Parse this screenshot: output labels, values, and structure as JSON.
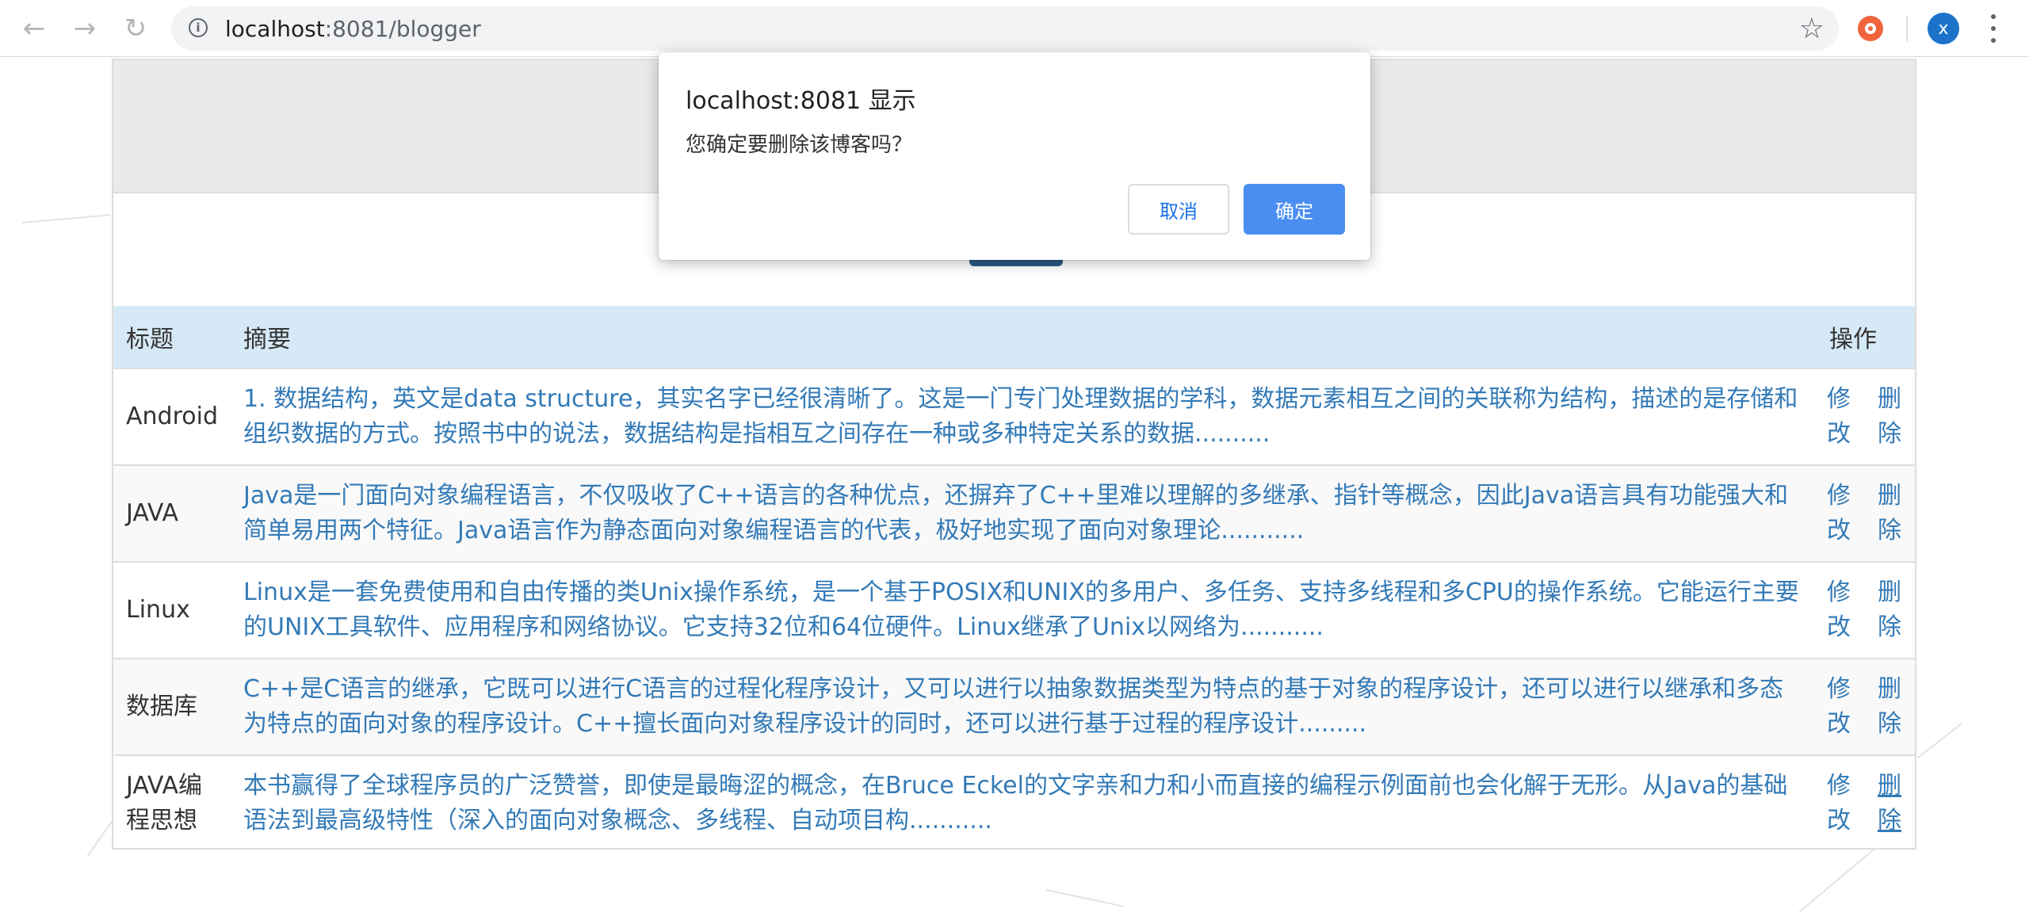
{
  "browser": {
    "url_host": "localhost",
    "url_path": ":8081/blogger",
    "back_icon": "←",
    "forward_icon": "→",
    "reload_icon": "↻",
    "info_icon": "i",
    "star_icon": "☆",
    "profile_initial": "x"
  },
  "table": {
    "headers": {
      "title": "标题",
      "summary": "摘要",
      "operations": "操作"
    },
    "rows": [
      {
        "title": "Android",
        "summary": "1. 数据结构，英文是data structure，其实名字已经很清晰了。这是一门专门处理数据的学科，数据元素相互之间的关联称为结构，描述的是存储和组织数据的方式。按照书中的说法，数据结构是指相互之间存在一种或多种特定关系的数据..........",
        "edit": "修改",
        "delete": "删除"
      },
      {
        "title": "JAVA",
        "summary": "Java是一门面向对象编程语言，不仅吸收了C++语言的各种优点，还摒弃了C++里难以理解的多继承、指针等概念，因此Java语言具有功能强大和简单易用两个特征。Java语言作为静态面向对象编程语言的代表，极好地实现了面向对象理论...........",
        "edit": "修改",
        "delete": "删除"
      },
      {
        "title": "Linux",
        "summary": "Linux是一套免费使用和自由传播的类Unix操作系统，是一个基于POSIX和UNIX的多用户、多任务、支持多线程和多CPU的操作系统。它能运行主要的UNIX工具软件、应用程序和网络协议。它支持32位和64位硬件。Linux继承了Unix以网络为...........",
        "edit": "修改",
        "delete": "删除"
      },
      {
        "title": "数据库",
        "summary": "C++是C语言的继承，它既可以进行C语言的过程化程序设计，又可以进行以抽象数据类型为特点的基于对象的程序设计，还可以进行以继承和多态为特点的面向对象的程序设计。C++擅长面向对象程序设计的同时，还可以进行基于过程的程序设计.........",
        "edit": "修改",
        "delete": "删除"
      },
      {
        "title": "JAVA编程思想",
        "summary": "本书赢得了全球程序员的广泛赞誉，即使是最晦涩的概念，在Bruce Eckel的文字亲和力和小而直接的编程示例面前也会化解于无形。从Java的基础语法到最高级特性（深入的面向对象概念、多线程、自动项目构...........",
        "edit": "修改",
        "delete": "删除"
      }
    ]
  },
  "dialog": {
    "title": "localhost:8081 显示",
    "message": "您确定要删除该博客吗？",
    "cancel_label": "取消",
    "ok_label": "确定"
  }
}
